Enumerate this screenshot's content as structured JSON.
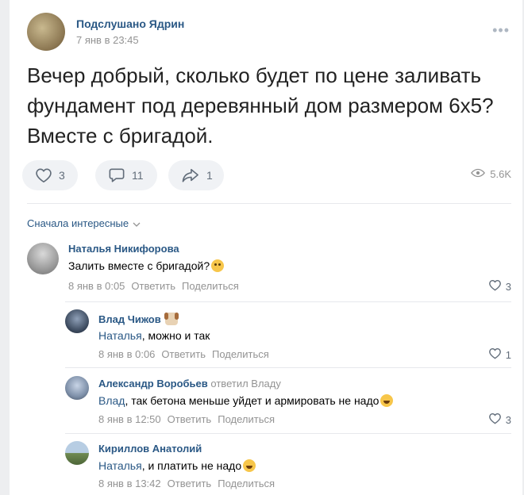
{
  "post": {
    "group_name": "Подслушано Ядрин",
    "date": "7 янв в 23:45",
    "more_icon": "more-horizontal-icon",
    "text": "Вечер добрый, сколько будет по цене заливать фундамент под деревянный дом размером 6х5? Вместе с бригадой.",
    "likes": "3",
    "comments": "11",
    "shares": "1",
    "views": "5.6K"
  },
  "comments_section": {
    "sort_label": "Сначала интересные"
  },
  "comments": [
    {
      "author": "Наталья Никифорова",
      "text": "Залить вместе с бригадой?",
      "emoji": "thinking-face",
      "date": "8 янв в 0:05",
      "reply_label": "Ответить",
      "share_label": "Поделиться",
      "likes": "3"
    },
    {
      "author": "Влад Чижов",
      "author_emoji": "dog-face",
      "mention": "Наталья",
      "text": ", можно и так",
      "date": "8 янв в 0:06",
      "reply_label": "Ответить",
      "share_label": "Поделиться",
      "likes": "1"
    },
    {
      "author": "Александр Воробьев",
      "reply_to": "ответил Владу",
      "mention": "Влад",
      "text": ", так бетона меньше уйдет и армировать не надо",
      "emoji": "rolling-laughing-face",
      "date": "8 янв в 12:50",
      "reply_label": "Ответить",
      "share_label": "Поделиться",
      "likes": "3"
    },
    {
      "author": "Кириллов Анатолий",
      "mention": "Наталья",
      "text": ", и платить не надо",
      "emoji": "grinning-face",
      "date": "8 янв в 13:42",
      "reply_label": "Ответить",
      "share_label": "Поделиться"
    }
  ],
  "colors": {
    "link": "#2a5885",
    "meta": "#939393",
    "button_bg": "#f0f2f5"
  }
}
